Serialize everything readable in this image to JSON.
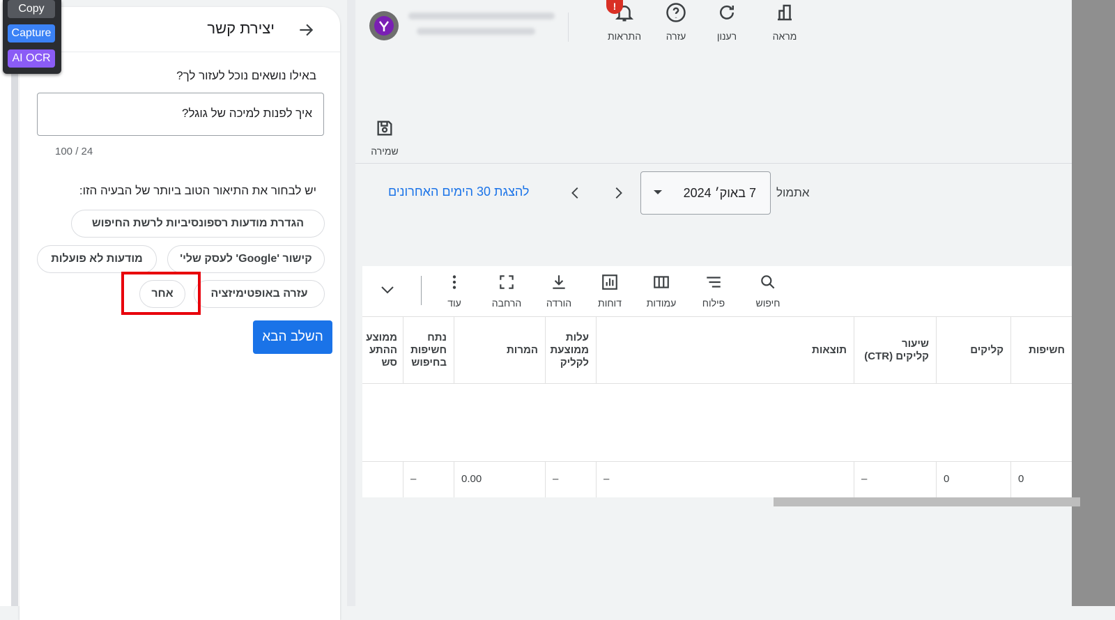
{
  "capture_tool": {
    "copy": "Copy",
    "capture": "Capture",
    "ai_ocr": "AI OCR"
  },
  "contact_panel": {
    "title": "יצירת קשר",
    "topics_question": "באילו נושאים נוכל לעזור לך?",
    "topic_input_value": "איך לפנות למיכה של גוגל?",
    "char_counter": "100 / 24",
    "describe_question": "יש לבחור את התיאור הטוב ביותר של הבעיה הזו:",
    "chips": [
      "הגדרת מודעות רספונסיביות לרשת החיפוש",
      "קישור 'Google' לעסק שלי'",
      "מודעות לא פועלות",
      "עזרה באופטימיזציה",
      "אחר"
    ],
    "next_button": "השלב הבא"
  },
  "header": {
    "alert_badge": "!",
    "icons": [
      {
        "name": "bell-icon",
        "label": "התראות"
      },
      {
        "name": "help-icon",
        "label": "עזרה"
      },
      {
        "name": "refresh-icon",
        "label": "רענון"
      },
      {
        "name": "appearance-icon",
        "label": "מראה"
      }
    ]
  },
  "save": {
    "label": "שמירה"
  },
  "date_range": {
    "show_last_30": "להצגת 30 הימים האחרונים",
    "from_label": "אתמול",
    "date_value": "7 באוק׳ 2024"
  },
  "toolbar": {
    "search": "חיפוש",
    "filter": "פילוח",
    "columns": "עמודות",
    "reports": "דוחות",
    "download": "הורדה",
    "expand": "הרחבה",
    "more": "עוד"
  },
  "table": {
    "headers": [
      "חשיפות",
      "קליקים",
      "שיעור\nקליקים (CTR)",
      "תוצאות",
      "עלות\nממוצעת\nלקליק",
      "המרות",
      "נתח\nחשיפות\nבחיפוש",
      "ממוצע\nההתע\nסש"
    ],
    "row": [
      "0",
      "0",
      "–",
      "–",
      "–",
      "0.00",
      "–",
      ""
    ]
  },
  "colors": {
    "accent": "#1a73e8",
    "alert": "#d93025",
    "highlight": "#e8000b"
  }
}
